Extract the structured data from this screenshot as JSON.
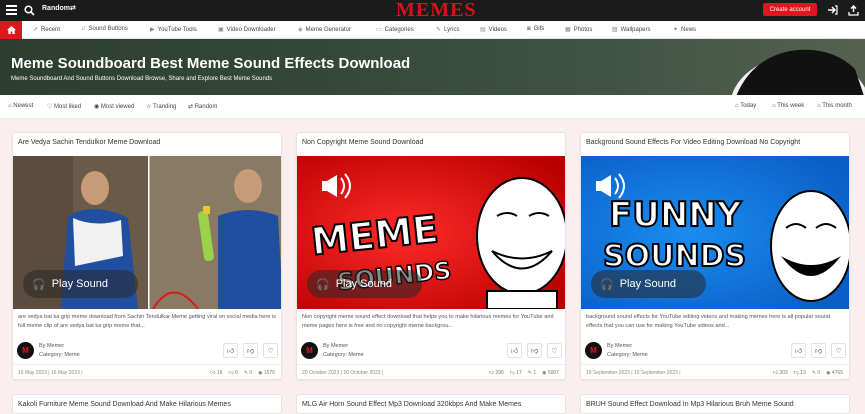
{
  "topbar": {
    "random_label": "Random",
    "logo": "MEMES",
    "create_account": "Create account"
  },
  "nav": {
    "items": [
      "Recent",
      "Sound Buttons",
      "YouTube Tools",
      "Video Downloader",
      "Meme Generator",
      "Categories",
      "Lyrics",
      "Videos",
      "Gifs",
      "Photos",
      "Wallpapers",
      "News"
    ]
  },
  "hero": {
    "title": "Meme Soundboard Best Meme Sound Effects Download",
    "subtitle": "Meme Soundboard And Sound Buttons Download Browse, Share and Explore Best Meme Sounds"
  },
  "filters": {
    "left": [
      "Newest",
      "Most liked",
      "Most viewed",
      "Tranding",
      "Random"
    ],
    "right": [
      "Today",
      "This week",
      "This month"
    ]
  },
  "cards": [
    {
      "title": "Are Vedya Sachin Tendulkor Meme Download",
      "play": "Play Sound",
      "desc": "are vedya bat ka grip meme download from Sachin Tendulkar Meme getting viral on social media here is full meme clip of are vedya bat ka grip meme that...",
      "by": "By Memer",
      "category": "Category: Meme",
      "date": "16 May 2023 | 16 May 2023 |",
      "stats": [
        "16",
        "0",
        "0",
        "1576"
      ]
    },
    {
      "title": "Non Copyright Meme Sound Download",
      "play": "Play Sound",
      "desc": "Non copyright meme sound effect download that helps you to make hilarious memes for YouTube and meme pages here is free and no copyright meme backgrou...",
      "by": "By Memer",
      "category": "Category: Meme",
      "date": "20 October 2023 | 20 October 2023 |",
      "stats": [
        "290",
        "17",
        "1",
        "5007"
      ],
      "img_text_1": "MEME",
      "img_text_2": "SOUNDS"
    },
    {
      "title": "Background Sound Effects For Video Editing Download No Copyright",
      "play": "Play Sound",
      "desc": "background sound effects for YouTube editing videos and making memes here is all popular sound effects that you can use for making YouTube videos and...",
      "by": "By Memer",
      "category": "Category: Meme",
      "date": "15 September 2023 | 15 September 2023 |",
      "stats": [
        "303",
        "13",
        "0",
        "4765"
      ],
      "img_text_1": "FUNNY",
      "img_text_2": "SOUNDS"
    }
  ],
  "row2": [
    "Kakoli Furniture Meme Sound Download And Make Hilarious Memes",
    "MLG Air Horn Sound Effect Mp3 Download 320kbps And Make Memes",
    "BRUH Sound Effect Download In Mp3 Hilarious Bruh Meme Sound"
  ],
  "colors": {
    "accent": "#e0161e",
    "topbar": "#1b1b1b",
    "hero": "#34493a",
    "page_bg": "#fbeeee"
  }
}
